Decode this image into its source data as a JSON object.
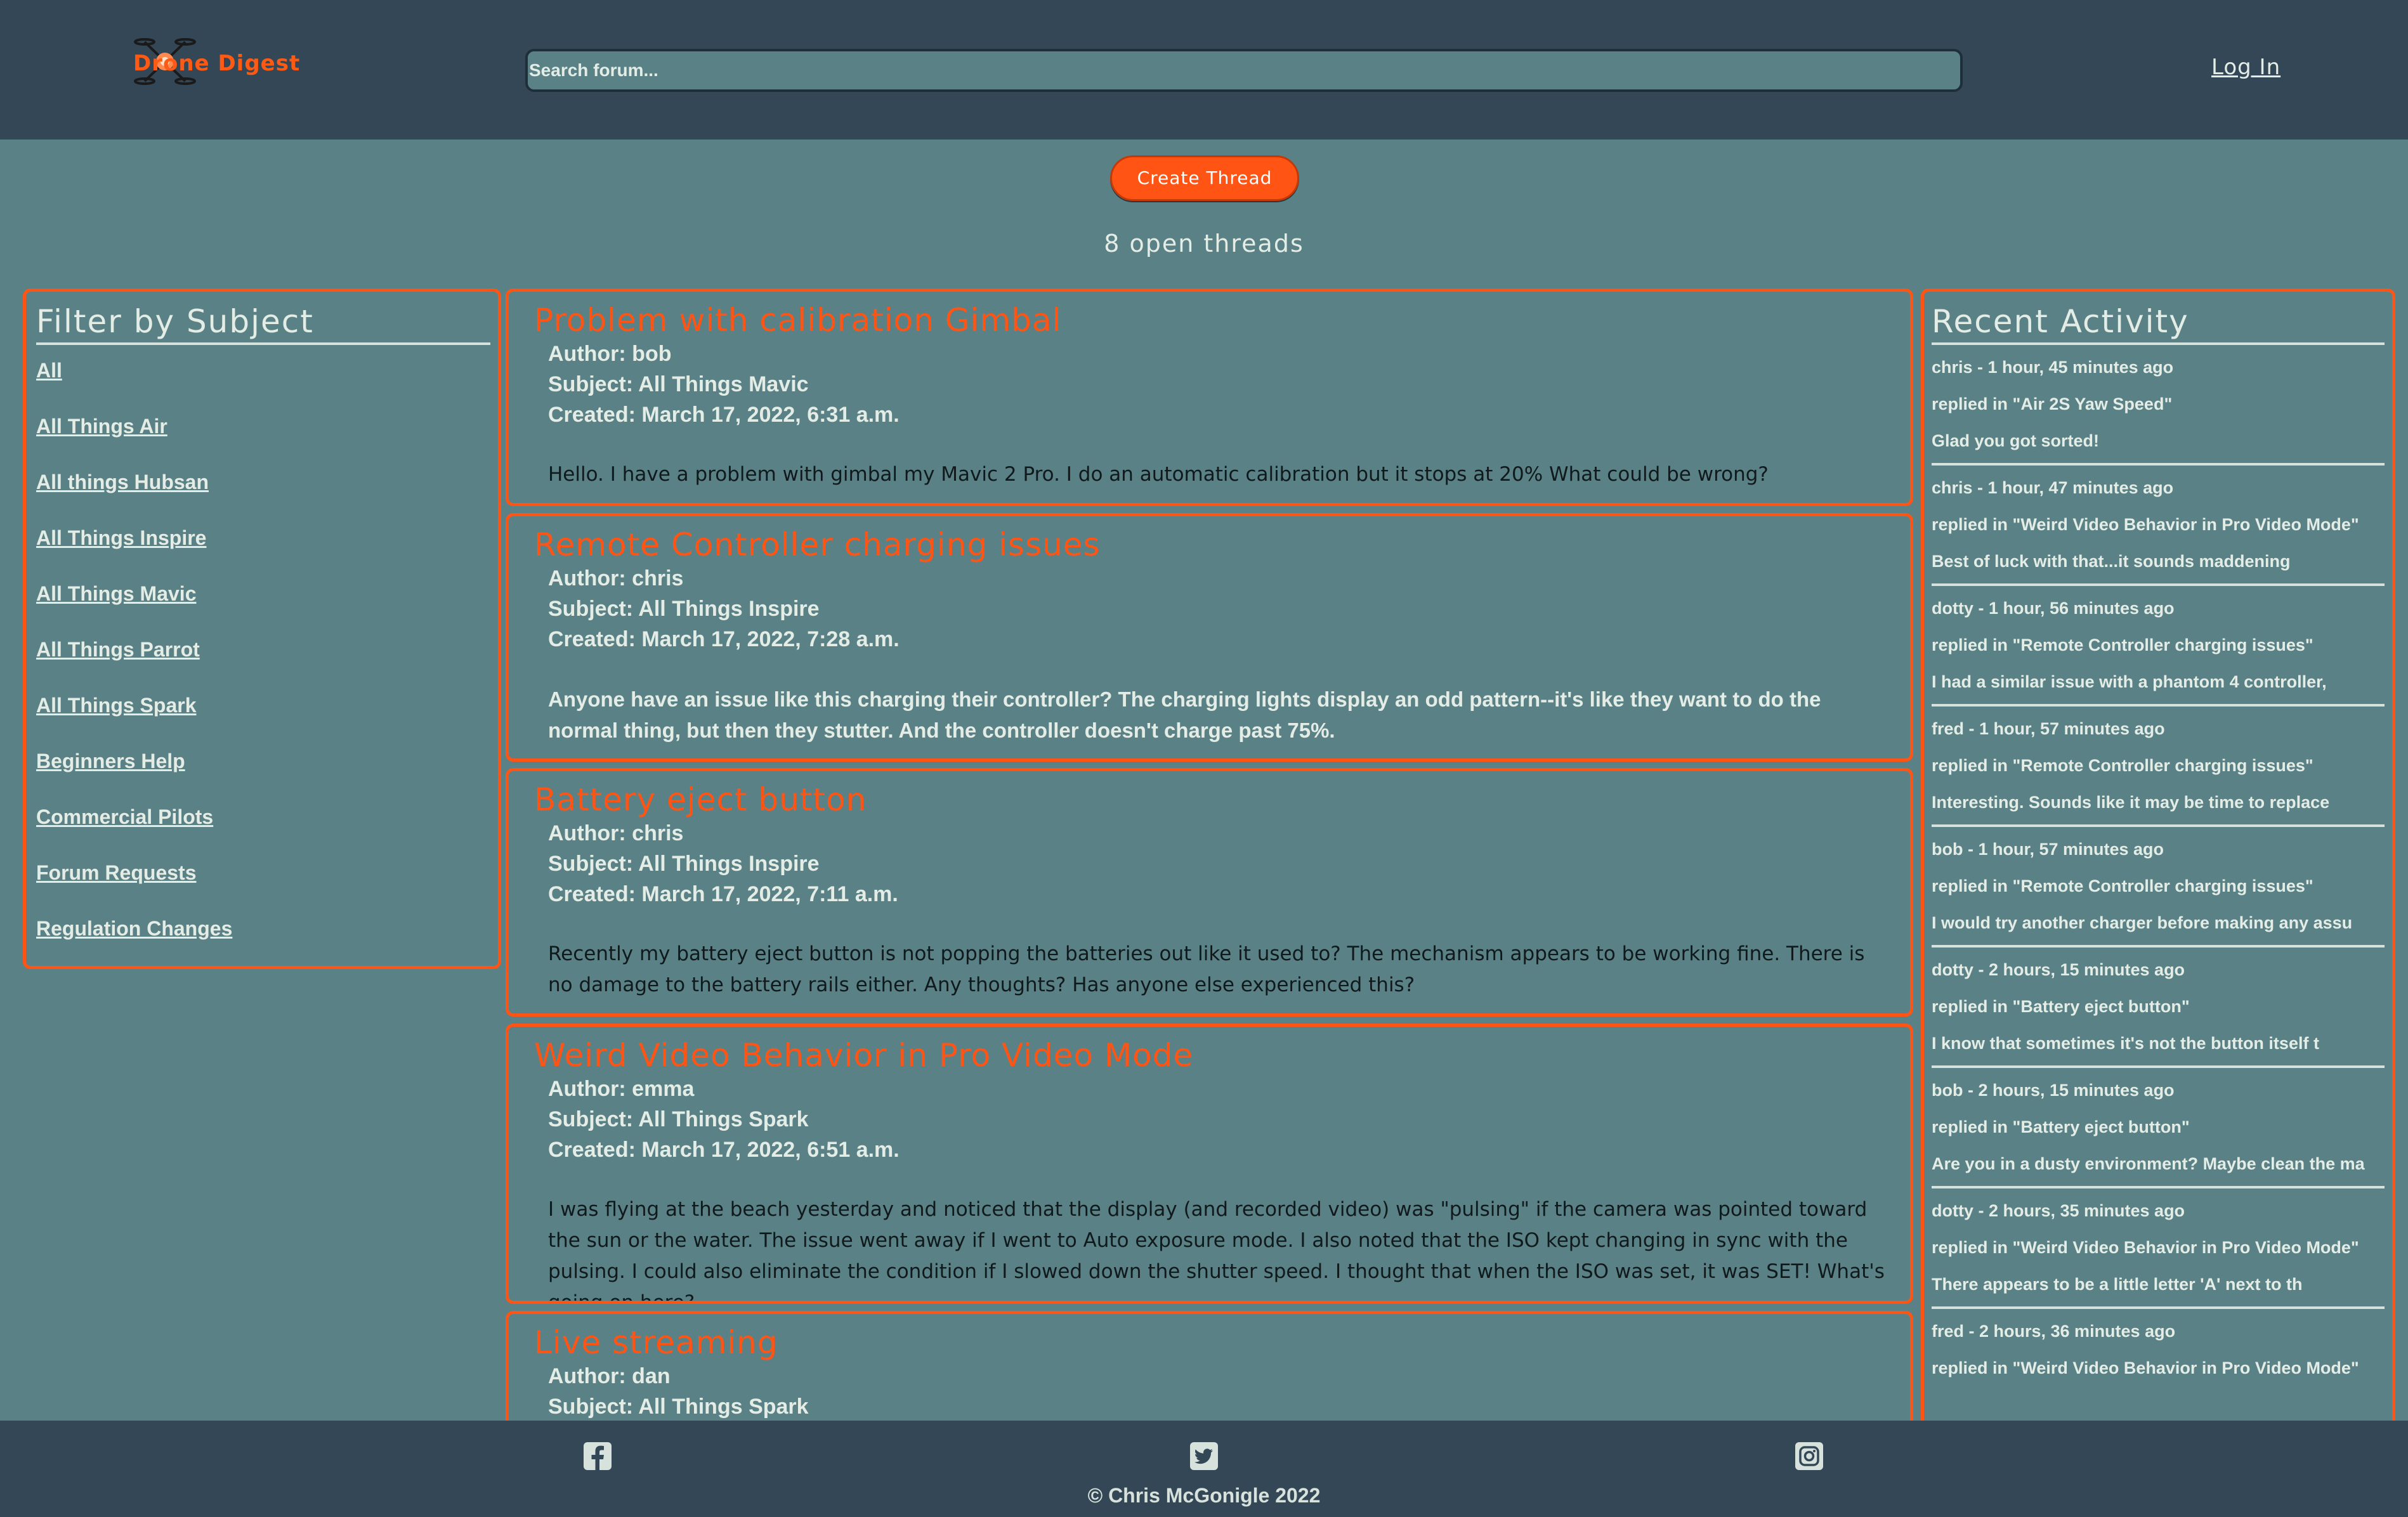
{
  "header": {
    "logo_text": "Drone Digest",
    "search_placeholder": "Search forum...",
    "login_label": "Log In"
  },
  "actions": {
    "create_thread_label": "Create Thread",
    "open_threads_text": "8 open threads"
  },
  "filter": {
    "title": "Filter by Subject",
    "items": [
      "All",
      "All Things Air",
      "All things Hubsan",
      "All Things Inspire",
      "All Things Mavic",
      "All Things Parrot",
      "All Things Spark",
      "Beginners Help",
      "Commercial Pilots",
      "Forum Requests",
      "Regulation Changes"
    ]
  },
  "threads": [
    {
      "title": "Problem with calibration Gimbal",
      "author": "Author: bob",
      "subject": "Subject: All Things Mavic",
      "created": "Created: March 17, 2022, 6:31 a.m.",
      "body": "Hello. I have a problem with gimbal my Mavic 2 Pro. I do an automatic calibration but it stops at 20% What could be wrong?"
    },
    {
      "title": "Remote Controller charging issues",
      "author": "Author: chris",
      "subject": "Subject: All Things Inspire",
      "created": "Created: March 17, 2022, 7:28 a.m.",
      "body": "Anyone have an issue like this charging their controller? The charging lights display an odd pattern--it's like they want to do the normal thing, but then they stutter. And the controller doesn't charge past 75%."
    },
    {
      "title": "Battery eject button",
      "author": "Author: chris",
      "subject": "Subject: All Things Inspire",
      "created": "Created: March 17, 2022, 7:11 a.m.",
      "body": "Recently my battery eject button is not popping the batteries out like it used to? The mechanism appears to be working fine. There is no damage to the battery rails either. Any thoughts? Has anyone else experienced this?"
    },
    {
      "title": "Weird Video Behavior in Pro Video Mode",
      "author": "Author: emma",
      "subject": "Subject: All Things Spark",
      "created": "Created: March 17, 2022, 6:51 a.m.",
      "body": "I was flying at the beach yesterday and noticed that the display (and recorded video) was \"pulsing\" if the camera was pointed toward the sun or the water. The issue went away if I went to Auto exposure mode. I also noted that the ISO kept changing in sync with the pulsing. I could also eliminate the condition if I slowed down the shutter speed. I thought that when the ISO was set, it was SET! What's going on here?"
    },
    {
      "title": "Live streaming",
      "author": "Author: dan",
      "subject": "Subject: All Things Spark",
      "created": "",
      "body": ""
    }
  ],
  "activity": {
    "title": "Recent Activity",
    "items": [
      {
        "who": "chris - 1 hour, 45 minutes ago",
        "where": "replied in \"Air 2S Yaw Speed\"",
        "text": "Glad you got sorted!"
      },
      {
        "who": "chris - 1 hour, 47 minutes ago",
        "where": "replied in \"Weird Video Behavior in Pro Video Mode\"",
        "text": "Best of luck with that...it sounds maddening"
      },
      {
        "who": "dotty - 1 hour, 56 minutes ago",
        "where": "replied in \"Remote Controller charging issues\"",
        "text": "I had a similar issue with a phantom 4 controller,"
      },
      {
        "who": "fred - 1 hour, 57 minutes ago",
        "where": "replied in \"Remote Controller charging issues\"",
        "text": "Interesting. Sounds like it may be time to replace"
      },
      {
        "who": "bob - 1 hour, 57 minutes ago",
        "where": "replied in \"Remote Controller charging issues\"",
        "text": "I would try another charger before making any assu"
      },
      {
        "who": "dotty - 2 hours, 15 minutes ago",
        "where": "replied in \"Battery eject button\"",
        "text": "I know that sometimes it's not the button itself t"
      },
      {
        "who": "bob - 2 hours, 15 minutes ago",
        "where": "replied in \"Battery eject button\"",
        "text": "Are you in a dusty environment? Maybe clean the ma"
      },
      {
        "who": "dotty - 2 hours, 35 minutes ago",
        "where": "replied in \"Weird Video Behavior in Pro Video Mode\"",
        "text": "There appears to be a little letter 'A' next to th"
      },
      {
        "who": "fred - 2 hours, 36 minutes ago",
        "where": "replied in \"Weird Video Behavior in Pro Video Mode\"",
        "text": ""
      }
    ]
  },
  "footer": {
    "icons": [
      "facebook-icon",
      "twitter-icon",
      "instagram-icon"
    ],
    "copyright": "© Chris McGonigle 2022"
  },
  "colors": {
    "header_bg": "#334756",
    "page_bg": "#5a8286",
    "accent": "#ff5414",
    "text": "#e4ece6"
  }
}
